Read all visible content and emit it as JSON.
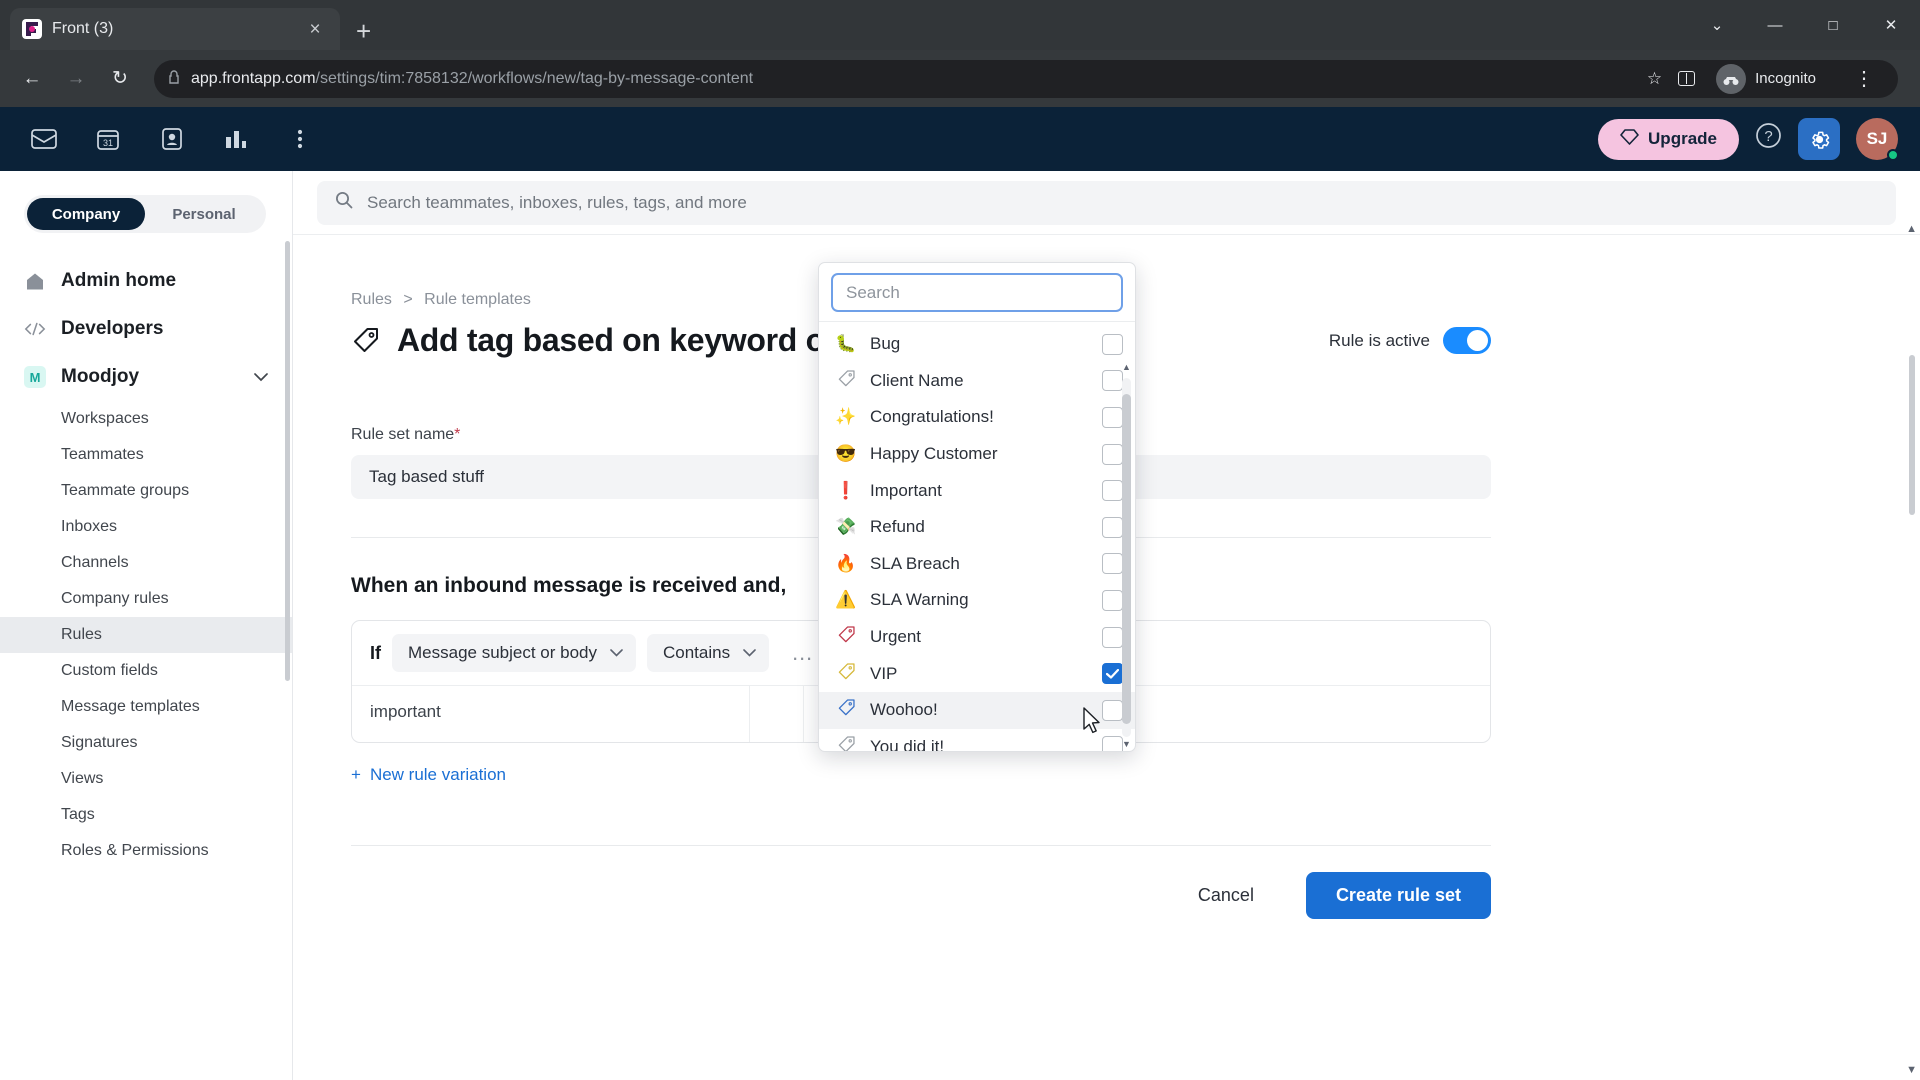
{
  "browser": {
    "tab": {
      "title": "Front (3)",
      "favicon": "front-logo-icon",
      "close": "×"
    },
    "new_tab": "+",
    "window": {
      "minimize": "—",
      "maximize": "□",
      "close": "✕",
      "chevron": "⌄"
    },
    "nav": {
      "back": "←",
      "forward": "→",
      "reload": "↻"
    },
    "url": {
      "lock": "🔒",
      "domain": "app.frontapp.com",
      "path": "/settings/tim:7858132/workflows/new/tag-by-message-content"
    },
    "omni": {
      "star": "☆",
      "side_panel": "side-panel-icon",
      "profile_label": "Incognito",
      "menu": "⋮"
    }
  },
  "topbar": {
    "icons": [
      "inbox-icon",
      "calendar-icon",
      "contacts-icon",
      "analytics-icon",
      "more-icon"
    ],
    "calendar_day": "31",
    "upgrade_label": "Upgrade",
    "help": "?",
    "gear": "gear-icon",
    "avatar_initials": "SJ"
  },
  "sidebar": {
    "segments": [
      {
        "label": "Company",
        "active": true
      },
      {
        "label": "Personal",
        "active": false
      }
    ],
    "nav": [
      {
        "label": "Admin home",
        "icon": "home-icon"
      },
      {
        "label": "Developers",
        "icon": "code-icon"
      }
    ],
    "group": {
      "badge": "M",
      "label": "Moodjoy",
      "chevron": "⌄",
      "items": [
        {
          "label": "Workspaces",
          "active": false
        },
        {
          "label": "Teammates",
          "active": false
        },
        {
          "label": "Teammate groups",
          "active": false
        },
        {
          "label": "Inboxes",
          "active": false
        },
        {
          "label": "Channels",
          "active": false
        },
        {
          "label": "Company rules",
          "active": false
        },
        {
          "label": "Rules",
          "active": true
        },
        {
          "label": "Custom fields",
          "active": false
        },
        {
          "label": "Message templates",
          "active": false
        },
        {
          "label": "Signatures",
          "active": false
        },
        {
          "label": "Views",
          "active": false
        },
        {
          "label": "Tags",
          "active": false
        },
        {
          "label": "Roles & Permissions",
          "active": false
        }
      ]
    }
  },
  "search": {
    "placeholder": "Search teammates, inboxes, rules, tags, and more",
    "icon": "search-icon"
  },
  "page": {
    "breadcrumb": {
      "parent": "Rules",
      "separator": ">",
      "current": "Rule templates"
    },
    "title": "Add tag based on keyword or",
    "title_icon": "tag-icon",
    "rule_active_label": "Rule is active",
    "rule_active_on": true,
    "field": {
      "label": "Rule set name",
      "required_mark": "*",
      "value": "Tag based stuff"
    },
    "section_title": "When an inbound message is received and,",
    "condition": {
      "if_label": "If",
      "field_select": "Message subject or body",
      "operator_select": "Contains",
      "chevron": "⌄",
      "more": "…",
      "value": "important",
      "tag_value": "VIP",
      "tag_icon": "tag-icon"
    },
    "new_variation": {
      "plus": "+",
      "label": "New rule variation"
    },
    "actions": {
      "cancel": "Cancel",
      "submit": "Create rule set"
    }
  },
  "dropdown": {
    "search_placeholder": "Search",
    "search_value": "",
    "scroll_down_arrow": "▼",
    "scroll_up_arrow": "▲",
    "items": [
      {
        "emoji": "🐛",
        "label": "Bug",
        "checked": false,
        "hover": false,
        "tag_color": ""
      },
      {
        "emoji": "",
        "label": "Client Name",
        "checked": false,
        "hover": false,
        "tag_color": "#9aa0a6"
      },
      {
        "emoji": "✨",
        "label": "Congratulations!",
        "checked": false,
        "hover": false,
        "tag_color": ""
      },
      {
        "emoji": "😎",
        "label": "Happy Customer",
        "checked": false,
        "hover": false,
        "tag_color": ""
      },
      {
        "emoji": "❗",
        "label": "Important",
        "checked": false,
        "hover": false,
        "tag_color": ""
      },
      {
        "emoji": "💸",
        "label": "Refund",
        "checked": false,
        "hover": false,
        "tag_color": ""
      },
      {
        "emoji": "🔥",
        "label": "SLA Breach",
        "checked": false,
        "hover": false,
        "tag_color": ""
      },
      {
        "emoji": "⚠️",
        "label": "SLA Warning",
        "checked": false,
        "hover": false,
        "tag_color": ""
      },
      {
        "emoji": "",
        "label": "Urgent",
        "checked": false,
        "hover": false,
        "tag_color": "#c0394b"
      },
      {
        "emoji": "",
        "label": "VIP",
        "checked": true,
        "hover": false,
        "tag_color": "#d6b93c"
      },
      {
        "emoji": "",
        "label": "Woohoo!",
        "checked": false,
        "hover": true,
        "tag_color": "#3a72c8"
      },
      {
        "emoji": "",
        "label": "You did it!",
        "checked": false,
        "hover": false,
        "tag_color": "#9aa0a6"
      }
    ]
  },
  "colors": {
    "topbar_bg": "#0b2238",
    "accent_blue": "#1a6fd4",
    "upgrade_pink": "#f5c4e0",
    "toggle_on": "#1a8cff"
  }
}
